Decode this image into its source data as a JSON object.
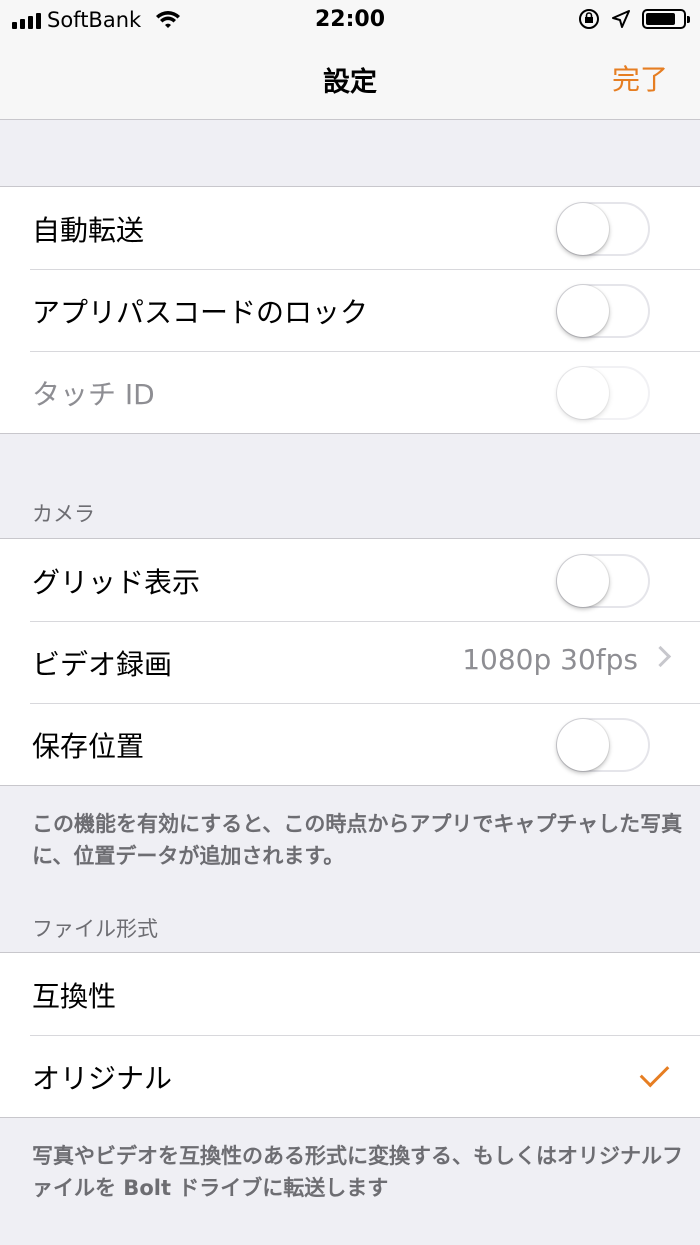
{
  "status_bar": {
    "carrier": "SoftBank",
    "time": "22:00",
    "icons": [
      "signal-icon",
      "wifi-icon",
      "orientation-lock-icon",
      "location-arrow-icon",
      "battery-icon"
    ]
  },
  "nav": {
    "title": "設定",
    "done_label": "完了"
  },
  "security": {
    "items": [
      {
        "label": "自動転送",
        "on": false
      },
      {
        "label": "アプリパスコードのロック",
        "on": false
      },
      {
        "label": "タッチ ID",
        "on": false,
        "disabled": true
      }
    ]
  },
  "camera": {
    "header": "カメラ",
    "grid_label": "グリッド表示",
    "video_label": "ビデオ録画",
    "video_value": "1080p 30fps",
    "location_label": "保存位置",
    "footer": "この機能を有効にすると、この時点からアプリでキャプチャした写真に、位置データが追加されます。"
  },
  "file_format": {
    "header": "ファイル形式",
    "options": [
      {
        "label": "互換性",
        "selected": false
      },
      {
        "label": "オリジナル",
        "selected": true
      }
    ],
    "footer": "写真やビデオを互換性のある形式に変換する、もしくはオリジナルファイルを Bolt ドライブに転送します"
  },
  "colors": {
    "accent": "#e67e22",
    "background": "#efeff4",
    "secondary_text": "#8e8e93"
  }
}
